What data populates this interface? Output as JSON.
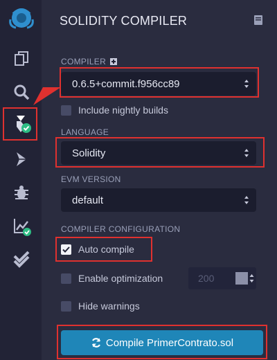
{
  "panel": {
    "title": "SOLIDITY COMPILER"
  },
  "compiler": {
    "label": "COMPILER",
    "selected_version": "0.6.5+commit.f956cc89",
    "nightly_label": "Include nightly builds",
    "nightly_checked": false
  },
  "language": {
    "label": "LANGUAGE",
    "selected": "Solidity"
  },
  "evm": {
    "label": "EVM VERSION",
    "selected": "default"
  },
  "config": {
    "label": "COMPILER CONFIGURATION",
    "auto_compile_label": "Auto compile",
    "auto_compile_checked": true,
    "optimization_label": "Enable optimization",
    "optimization_checked": false,
    "optimization_runs": "200",
    "hide_warnings_label": "Hide warnings",
    "hide_warnings_checked": false
  },
  "compile_button": {
    "label": "Compile PrimerContrato.sol"
  },
  "sidebar": {
    "items": [
      {
        "icon": "file-explorer-icon"
      },
      {
        "icon": "search-icon"
      },
      {
        "icon": "solidity-compiler-icon",
        "active": true
      },
      {
        "icon": "deploy-run-icon"
      },
      {
        "icon": "debugger-icon"
      },
      {
        "icon": "analysis-icon"
      },
      {
        "icon": "unit-testing-icon"
      }
    ]
  },
  "colors": {
    "rail_bg": "#222336",
    "panel_bg": "#2a2c3f",
    "input_bg": "#1b1d2e",
    "accent": "#1f86b8",
    "highlight": "#e0312f",
    "success": "#2ebd84"
  }
}
